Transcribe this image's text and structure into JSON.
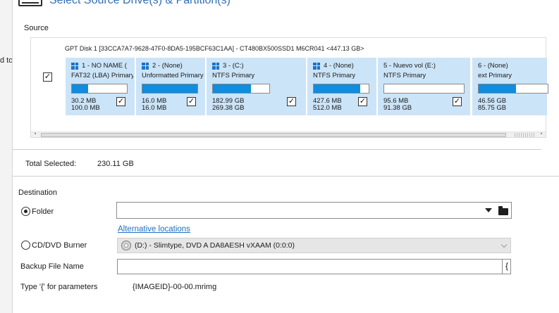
{
  "background": {
    "fragment_text": "d to"
  },
  "dialog": {
    "title": "Select Source Drive(s) & Partition(s)"
  },
  "source": {
    "label": "Source",
    "disk": {
      "title": "GPT Disk 1 [33CCA7A7-9628-47F0-8DA5-195BCF63C1AA] - CT480BX500SSD1 M6CR041  <447.13 GB>",
      "checked": true,
      "partitions": [
        {
          "head": "1 - NO NAME (",
          "type": "FAT32 (LBA) Primary",
          "used": "30.2 MB",
          "total": "100.0 MB",
          "fill_fraction": 0.3,
          "windows_icon": true,
          "checked": true
        },
        {
          "head": "2 -  (None)",
          "type": "Unformatted Primary",
          "used": "16.0 MB",
          "total": "16.0 MB",
          "fill_fraction": 1.0,
          "windows_icon": true,
          "checked": true
        },
        {
          "head": "3 -  (C:)",
          "type": "NTFS Primary",
          "used": "182.99 GB",
          "total": "269.38 GB",
          "fill_fraction": 0.68,
          "windows_icon": true,
          "checked": true
        },
        {
          "head": "4 -  (None)",
          "type": "NTFS Primary",
          "used": "427.6 MB",
          "total": "512.0 MB",
          "fill_fraction": 0.84,
          "windows_icon": true,
          "checked": true
        },
        {
          "head": "5 - Nuevo vol (E:)",
          "type": "NTFS Primary",
          "used": "95.6 MB",
          "total": "91.38 GB",
          "fill_fraction": 0.0,
          "windows_icon": false,
          "checked": true
        },
        {
          "head": "6 -  (None)",
          "type": "ext Primary",
          "used": "46.56 GB",
          "total": "85.75 GB",
          "fill_fraction": 0.54,
          "windows_icon": false,
          "checked": false
        }
      ]
    }
  },
  "total_selected": {
    "label": "Total Selected:",
    "value": "230.11 GB"
  },
  "destination": {
    "label": "Destination",
    "folder": {
      "label": "Folder",
      "selected": true,
      "value": ""
    },
    "alt_locations_link": "Alternative locations",
    "burner": {
      "label": "CD/DVD Burner",
      "selected": false,
      "value": "(D:) - Slimtype, DVD A  DA8AESH   vXAAM (0:0:0)"
    },
    "backup_file": {
      "label": "Backup File Name",
      "value": "",
      "brace_button": "{"
    },
    "parameters": {
      "label": "Type '{' for parameters",
      "value": "{IMAGEID}-00-00.mrimg"
    }
  }
}
